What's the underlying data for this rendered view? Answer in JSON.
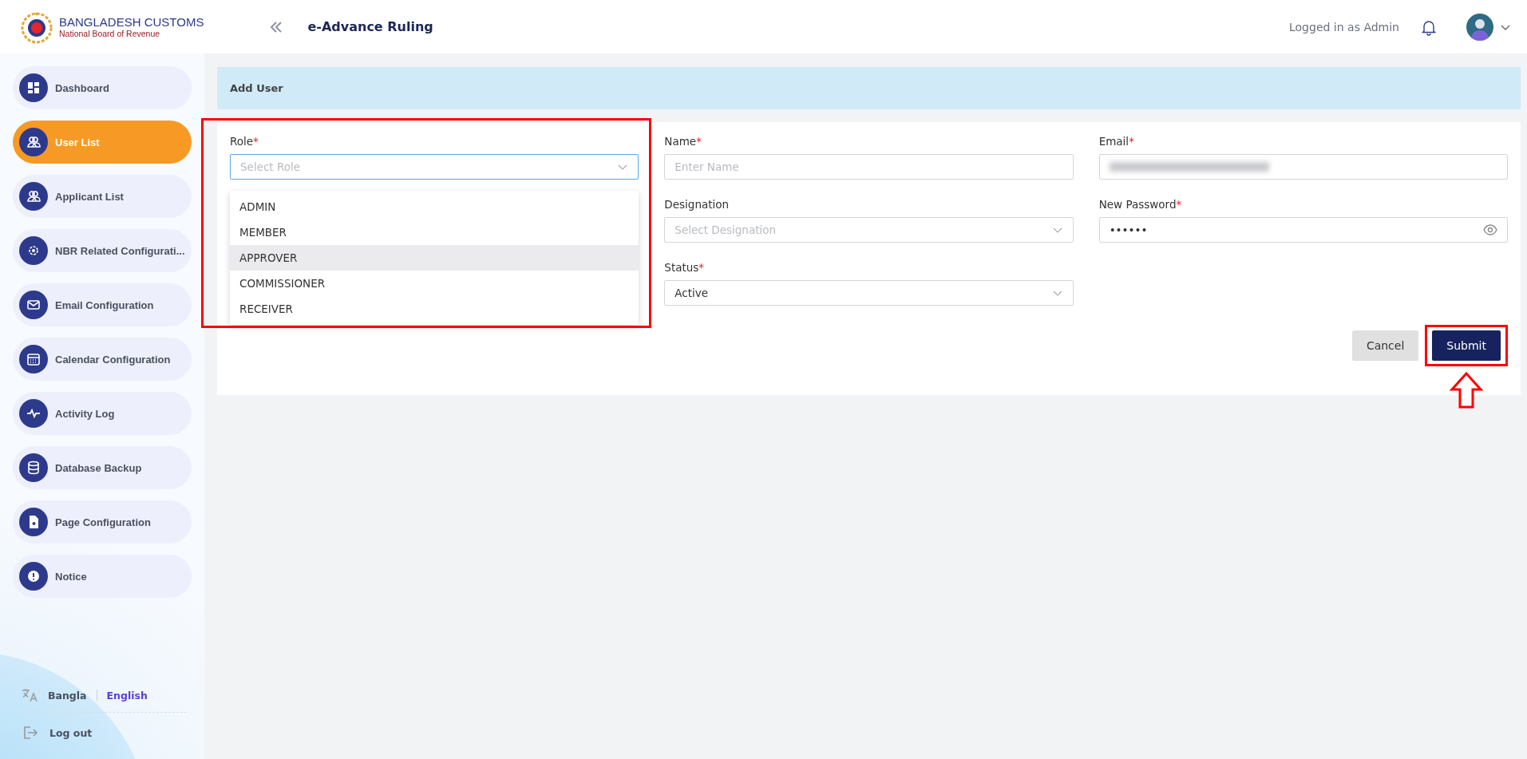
{
  "header": {
    "logo_title": "BANGLADESH CUSTOMS",
    "logo_subtitle": "National Board of Revenue",
    "app_title": "e-Advance Ruling",
    "user_label": "Logged in as Admin"
  },
  "sidebar": {
    "items": [
      {
        "label": "Dashboard",
        "selected": false
      },
      {
        "label": "User List",
        "selected": true
      },
      {
        "label": "Applicant List",
        "selected": false
      },
      {
        "label": "NBR Related Configurati...",
        "selected": false
      },
      {
        "label": "Email Configuration",
        "selected": false
      },
      {
        "label": "Calendar Configuration",
        "selected": false
      },
      {
        "label": "Activity Log",
        "selected": false
      },
      {
        "label": "Database Backup",
        "selected": false
      },
      {
        "label": "Page Configuration",
        "selected": false
      },
      {
        "label": "Notice",
        "selected": false
      }
    ],
    "languages": [
      {
        "label": "Bangla",
        "selected": false
      },
      {
        "label": "English",
        "selected": true
      }
    ],
    "logout": "Log out"
  },
  "page_title": "Add User",
  "form": {
    "columns": [
      [
        {
          "label": "Role",
          "required_mark": "*",
          "kind": "select",
          "placeholder": "Select Role",
          "focused": true,
          "highlighted": true,
          "options": [
            {
              "label": "ADMIN",
              "hovered": false
            },
            {
              "label": "MEMBER",
              "hovered": false
            },
            {
              "label": "APPROVER",
              "hovered": true
            },
            {
              "label": "COMMISSIONER",
              "hovered": false
            },
            {
              "label": "RECEIVER",
              "hovered": false
            }
          ]
        }
      ],
      [
        {
          "label": "Name",
          "required_mark": "*",
          "kind": "text",
          "placeholder": "Enter Name",
          "focused": false
        },
        {
          "label": "Designation",
          "kind": "select",
          "placeholder": "Select Designation",
          "focused": false
        },
        {
          "label": "Status",
          "required_mark": "*",
          "kind": "select",
          "value": "Active",
          "focused": false
        }
      ],
      [
        {
          "label": "Email",
          "required_mark": "*",
          "kind": "blurred",
          "focused": false
        },
        {
          "label": "New Password",
          "required_mark": "*",
          "kind": "password",
          "value": "••••••",
          "focused": false
        }
      ]
    ],
    "buttons": [
      {
        "label": "Cancel",
        "kind": "secondary"
      },
      {
        "label": "Submit",
        "kind": "primary",
        "highlighted": true
      }
    ]
  }
}
